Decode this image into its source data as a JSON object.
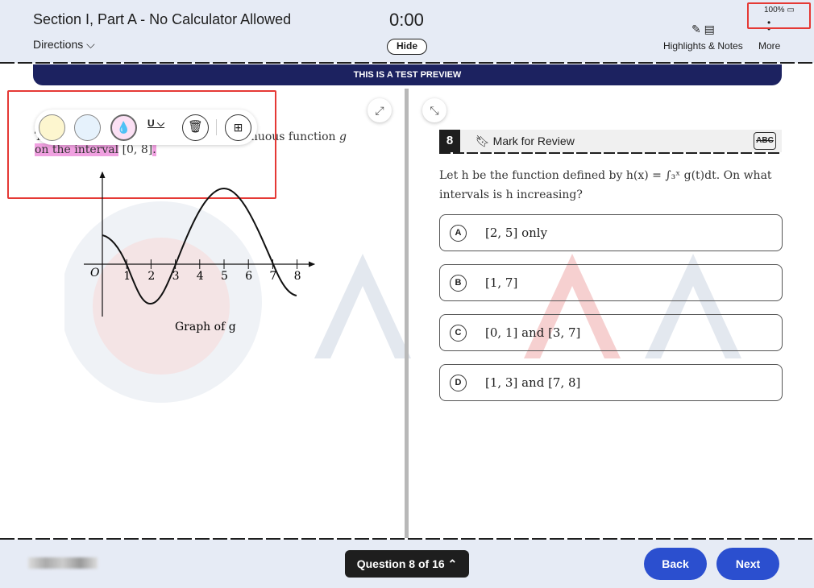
{
  "header": {
    "title": "Section I, Part A - No Calculator Allowed",
    "directions": "Directions",
    "timer": "0:00",
    "hide": "Hide",
    "highlights_notes": "Highlights & Notes",
    "more": "More",
    "battery": "100%"
  },
  "banner": "THIS IS A TEST PREVIEW",
  "passage": {
    "start": "T",
    "hidden_tail": "inuous function ",
    "var": "g",
    "highlighted": "on the interval",
    "interval": "[0, 8]",
    "period": "."
  },
  "graph": {
    "caption": "Graph of  g",
    "origin": "O",
    "x_ticks": [
      "1",
      "2",
      "3",
      "4",
      "5",
      "6",
      "7",
      "8"
    ]
  },
  "question": {
    "number": "8",
    "mark_label": "Mark for Review",
    "abc": "ABC",
    "stem": "Let h be the function defined by h(x) = ∫₃ˣ g(t)dt. On what intervals is h increasing?",
    "choices": [
      {
        "letter": "A",
        "text": "[2, 5] only"
      },
      {
        "letter": "B",
        "text": "[1, 7]"
      },
      {
        "letter": "C",
        "text": "[0, 1] and [3, 7]"
      },
      {
        "letter": "D",
        "text": "[1, 3] and [7, 8]"
      }
    ]
  },
  "footer": {
    "question_nav": "Question 8 of 16 ⌃",
    "back": "Back",
    "next": "Next"
  },
  "colors": {
    "accent": "#2b4fcf",
    "highlight": "#f0a0e0",
    "banner": "#1c2260"
  }
}
